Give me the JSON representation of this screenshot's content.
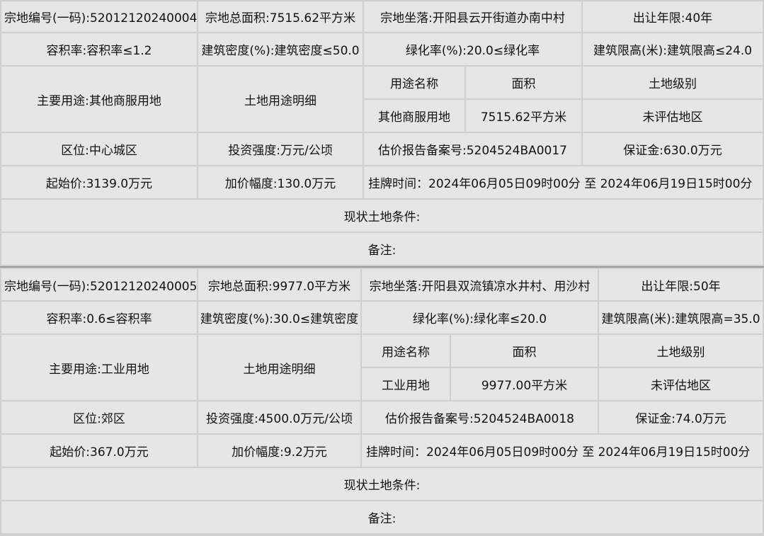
{
  "parcels": [
    {
      "parcel_no": "宗地编号(一码):52012120240004",
      "total_area": "宗地总面积:7515.62平方米",
      "location": "宗地坐落:开阳县云开街道办南中村",
      "term": "出让年限:40年",
      "far": "容积率:容积率≤1.2",
      "density": "建筑密度(%):建筑密度≤50.0",
      "green": "绿化率(%):20.0≤绿化率",
      "height": "建筑限高(米):建筑限高≤24.0",
      "main_use": "主要用途:其他商服用地",
      "use_detail_label": "土地用途明细",
      "use_name_header": "用途名称",
      "area_header": "面积",
      "grade_header": "土地级别",
      "use_name": "其他商服用地",
      "use_area": "7515.62平方米",
      "grade": "未评估地区",
      "zone": "区位:中心城区",
      "investment": "投资强度:万元/公顷",
      "appraisal": "估价报告备案号:5204524BA0017",
      "deposit": "保证金:630.0万元",
      "start_price": "起始价:3139.0万元",
      "increment": "加价幅度:130.0万元",
      "listing_time": "挂牌时间：2024年06月05日09时00分 至 2024年06月19日15时00分",
      "land_condition": "现状土地条件:",
      "remarks": "备注:"
    },
    {
      "parcel_no": "宗地编号(一码):52012120240005",
      "total_area": "宗地总面积:9977.0平方米",
      "location": "宗地坐落:开阳县双流镇凉水井村、用沙村",
      "term": "出让年限:50年",
      "far": "容积率:0.6≤容积率",
      "density": "建筑密度(%):30.0≤建筑密度",
      "green": "绿化率(%):绿化率≤20.0",
      "height": "建筑限高(米):建筑限高=35.0",
      "main_use": "主要用途:工业用地",
      "use_detail_label": "土地用途明细",
      "use_name_header": "用途名称",
      "area_header": "面积",
      "grade_header": "土地级别",
      "use_name": "工业用地",
      "use_area": "9977.00平方米",
      "grade": "未评估地区",
      "zone": "区位:郊区",
      "investment": "投资强度:4500.0万元/公顷",
      "appraisal": "估价报告备案号:5204524BA0018",
      "deposit": "保证金:74.0万元",
      "start_price": "起始价:367.0万元",
      "increment": "加价幅度:9.2万元",
      "listing_time": "挂牌时间：2024年06月05日09时00分 至 2024年06月19日15时00分",
      "land_condition": "现状土地条件:",
      "remarks": "备注:"
    }
  ]
}
